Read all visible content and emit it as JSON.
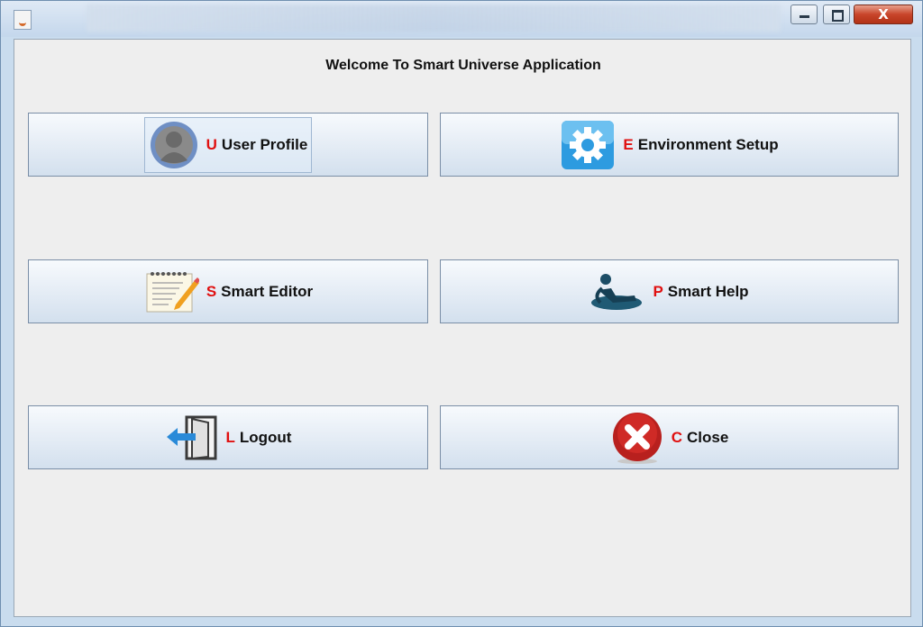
{
  "window": {
    "close_glyph": "X"
  },
  "welcome": "Welcome To Smart Universe Application",
  "buttons": {
    "user_profile": {
      "mnemonic": "U",
      "label": "User Profile",
      "icon": "user-avatar-icon"
    },
    "environment_setup": {
      "mnemonic": "E",
      "label": "Environment Setup",
      "icon": "gear-icon"
    },
    "smart_editor": {
      "mnemonic": "S",
      "label": "Smart Editor",
      "icon": "notepad-pencil-icon"
    },
    "smart_help": {
      "mnemonic": "P",
      "label": "Smart Help",
      "icon": "wheelchair-icon"
    },
    "logout": {
      "mnemonic": "L",
      "label": "Logout",
      "icon": "exit-door-icon"
    },
    "close": {
      "mnemonic": "C",
      "label": "Close",
      "icon": "close-x-icon"
    }
  },
  "colors": {
    "mnemonic": "#e01010",
    "close_red": "#b8201e",
    "gear_blue": "#2d9be0"
  }
}
